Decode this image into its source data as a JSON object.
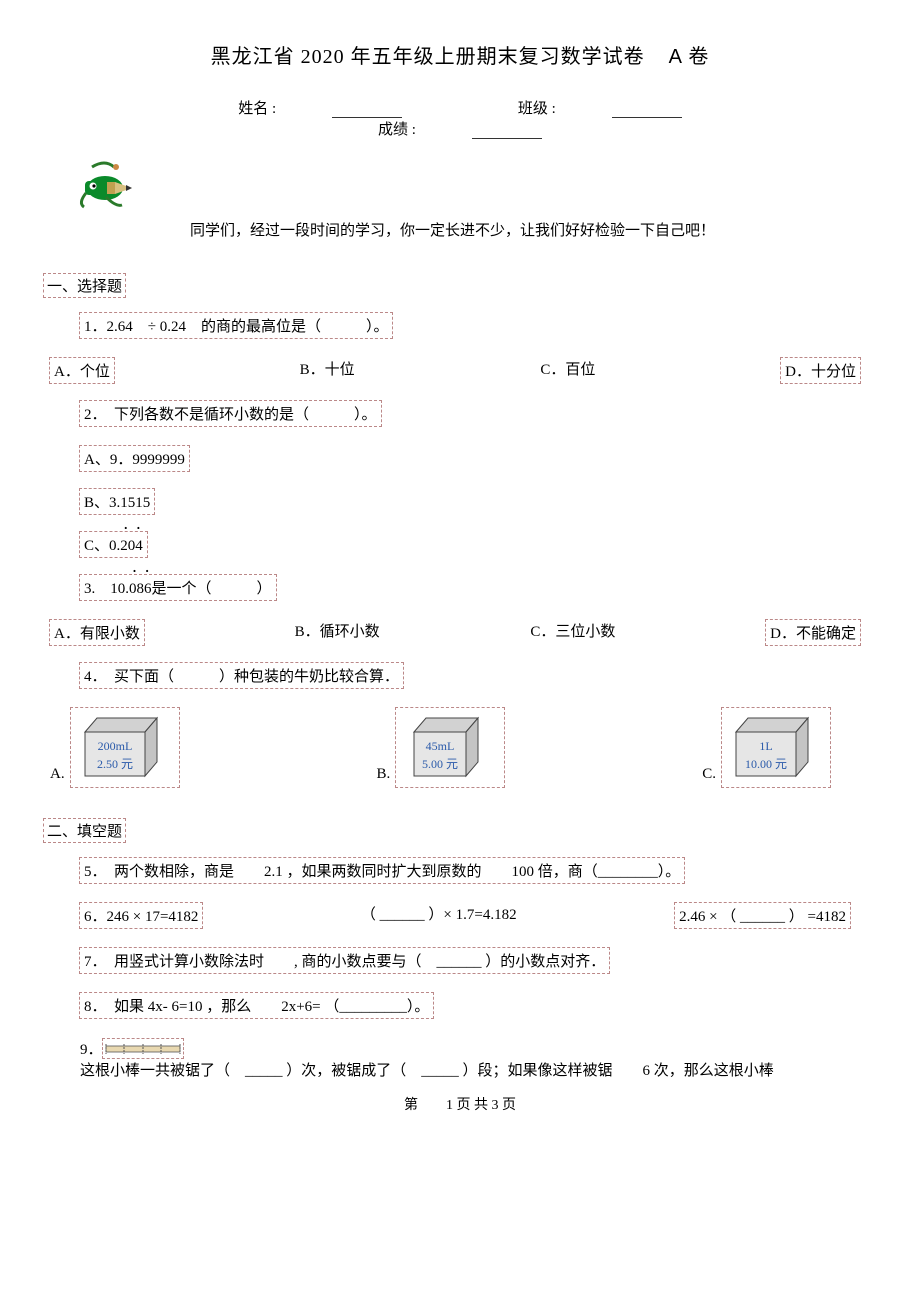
{
  "title_main": "黑龙江省 2020 年五年级上册期末复习数学试卷",
  "title_volume": "A 卷",
  "meta": {
    "name_label": "姓名 :",
    "class_label": "班级 :",
    "score_label": "成绩 :"
  },
  "intro": "同学们，经过一段时间的学习，你一定长进不少，让我们好好检验一下自己吧！",
  "section1": "一、选择题",
  "q1": {
    "text": "1．2.64　÷ 0.24　的商的最高位是（　　　）。",
    "a": "A．个位",
    "b": "B．十位",
    "c": "C．百位",
    "d": "D．十分位"
  },
  "q2": {
    "text": "2．　下列各数不是循环小数的是（　　　）。",
    "a": "A、9．9999999",
    "b_prefix": "B、3.1515",
    "c_prefix": "C、",
    "c_num_front": "0.",
    "c_num_cycle": "204"
  },
  "q3": {
    "text_prefix": "3.　",
    "num_front": "10.",
    "num_cycle": "086",
    "text_suffix": "是一个（　　　）",
    "a": "A．有限小数",
    "b": "B．循环小数",
    "c": "C．三位小数",
    "d": "D．不能确定"
  },
  "q4": {
    "text": "4．　买下面（　　　）种包装的牛奶比较合算．",
    "a_label": "A.",
    "a_vol": "200mL",
    "a_price": "2.50 元",
    "b_label": "B.",
    "b_vol": "45mL",
    "b_price": "5.00 元",
    "c_label": "C.",
    "c_vol": "1L",
    "c_price": "10.00 元"
  },
  "section2": "二、填空题",
  "q5": "5．　两个数相除，商是　　2.1 ，如果两数同时扩大到原数的　　100 倍，商（________）。",
  "q6": {
    "part1": "6．246  × 17=4182",
    "part2": "（ ______ ）×  1.7=4.182",
    "part3": "2.46 × （ ______ ） =4182"
  },
  "q7": "7．　用竖式计算小数除法时　　, 商的小数点要与（　______ ）的小数点对齐．",
  "q8": "8．　如果 4x- 6=10 ，那么　　2x+6= （_________）。",
  "q9": {
    "prefix": "9．",
    "text_after_img": "这根小棒一共被锯了（　_____ ）次，被锯成了（　_____ ）段；如果像这样被锯　　6 次，那么这根小棒"
  },
  "footer": "第　　1 页 共 3 页"
}
